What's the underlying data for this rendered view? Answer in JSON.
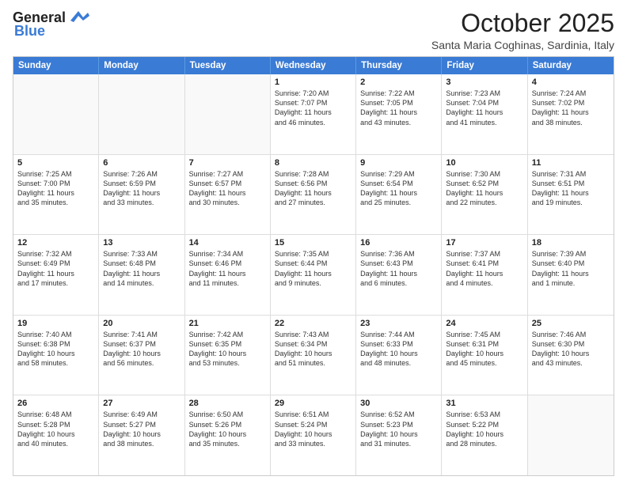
{
  "logo": {
    "line1": "General",
    "line2": "Blue"
  },
  "header": {
    "month": "October 2025",
    "location": "Santa Maria Coghinas, Sardinia, Italy"
  },
  "days": [
    "Sunday",
    "Monday",
    "Tuesday",
    "Wednesday",
    "Thursday",
    "Friday",
    "Saturday"
  ],
  "rows": [
    [
      {
        "day": "",
        "text": ""
      },
      {
        "day": "",
        "text": ""
      },
      {
        "day": "",
        "text": ""
      },
      {
        "day": "1",
        "text": "Sunrise: 7:20 AM\nSunset: 7:07 PM\nDaylight: 11 hours\nand 46 minutes."
      },
      {
        "day": "2",
        "text": "Sunrise: 7:22 AM\nSunset: 7:05 PM\nDaylight: 11 hours\nand 43 minutes."
      },
      {
        "day": "3",
        "text": "Sunrise: 7:23 AM\nSunset: 7:04 PM\nDaylight: 11 hours\nand 41 minutes."
      },
      {
        "day": "4",
        "text": "Sunrise: 7:24 AM\nSunset: 7:02 PM\nDaylight: 11 hours\nand 38 minutes."
      }
    ],
    [
      {
        "day": "5",
        "text": "Sunrise: 7:25 AM\nSunset: 7:00 PM\nDaylight: 11 hours\nand 35 minutes."
      },
      {
        "day": "6",
        "text": "Sunrise: 7:26 AM\nSunset: 6:59 PM\nDaylight: 11 hours\nand 33 minutes."
      },
      {
        "day": "7",
        "text": "Sunrise: 7:27 AM\nSunset: 6:57 PM\nDaylight: 11 hours\nand 30 minutes."
      },
      {
        "day": "8",
        "text": "Sunrise: 7:28 AM\nSunset: 6:56 PM\nDaylight: 11 hours\nand 27 minutes."
      },
      {
        "day": "9",
        "text": "Sunrise: 7:29 AM\nSunset: 6:54 PM\nDaylight: 11 hours\nand 25 minutes."
      },
      {
        "day": "10",
        "text": "Sunrise: 7:30 AM\nSunset: 6:52 PM\nDaylight: 11 hours\nand 22 minutes."
      },
      {
        "day": "11",
        "text": "Sunrise: 7:31 AM\nSunset: 6:51 PM\nDaylight: 11 hours\nand 19 minutes."
      }
    ],
    [
      {
        "day": "12",
        "text": "Sunrise: 7:32 AM\nSunset: 6:49 PM\nDaylight: 11 hours\nand 17 minutes."
      },
      {
        "day": "13",
        "text": "Sunrise: 7:33 AM\nSunset: 6:48 PM\nDaylight: 11 hours\nand 14 minutes."
      },
      {
        "day": "14",
        "text": "Sunrise: 7:34 AM\nSunset: 6:46 PM\nDaylight: 11 hours\nand 11 minutes."
      },
      {
        "day": "15",
        "text": "Sunrise: 7:35 AM\nSunset: 6:44 PM\nDaylight: 11 hours\nand 9 minutes."
      },
      {
        "day": "16",
        "text": "Sunrise: 7:36 AM\nSunset: 6:43 PM\nDaylight: 11 hours\nand 6 minutes."
      },
      {
        "day": "17",
        "text": "Sunrise: 7:37 AM\nSunset: 6:41 PM\nDaylight: 11 hours\nand 4 minutes."
      },
      {
        "day": "18",
        "text": "Sunrise: 7:39 AM\nSunset: 6:40 PM\nDaylight: 11 hours\nand 1 minute."
      }
    ],
    [
      {
        "day": "19",
        "text": "Sunrise: 7:40 AM\nSunset: 6:38 PM\nDaylight: 10 hours\nand 58 minutes."
      },
      {
        "day": "20",
        "text": "Sunrise: 7:41 AM\nSunset: 6:37 PM\nDaylight: 10 hours\nand 56 minutes."
      },
      {
        "day": "21",
        "text": "Sunrise: 7:42 AM\nSunset: 6:35 PM\nDaylight: 10 hours\nand 53 minutes."
      },
      {
        "day": "22",
        "text": "Sunrise: 7:43 AM\nSunset: 6:34 PM\nDaylight: 10 hours\nand 51 minutes."
      },
      {
        "day": "23",
        "text": "Sunrise: 7:44 AM\nSunset: 6:33 PM\nDaylight: 10 hours\nand 48 minutes."
      },
      {
        "day": "24",
        "text": "Sunrise: 7:45 AM\nSunset: 6:31 PM\nDaylight: 10 hours\nand 45 minutes."
      },
      {
        "day": "25",
        "text": "Sunrise: 7:46 AM\nSunset: 6:30 PM\nDaylight: 10 hours\nand 43 minutes."
      }
    ],
    [
      {
        "day": "26",
        "text": "Sunrise: 6:48 AM\nSunset: 5:28 PM\nDaylight: 10 hours\nand 40 minutes."
      },
      {
        "day": "27",
        "text": "Sunrise: 6:49 AM\nSunset: 5:27 PM\nDaylight: 10 hours\nand 38 minutes."
      },
      {
        "day": "28",
        "text": "Sunrise: 6:50 AM\nSunset: 5:26 PM\nDaylight: 10 hours\nand 35 minutes."
      },
      {
        "day": "29",
        "text": "Sunrise: 6:51 AM\nSunset: 5:24 PM\nDaylight: 10 hours\nand 33 minutes."
      },
      {
        "day": "30",
        "text": "Sunrise: 6:52 AM\nSunset: 5:23 PM\nDaylight: 10 hours\nand 31 minutes."
      },
      {
        "day": "31",
        "text": "Sunrise: 6:53 AM\nSunset: 5:22 PM\nDaylight: 10 hours\nand 28 minutes."
      },
      {
        "day": "",
        "text": ""
      }
    ]
  ]
}
